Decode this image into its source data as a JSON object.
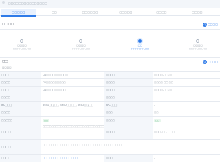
{
  "window": {
    "breadcrumb": "□□□□□□□□□□□□□□□"
  },
  "tabs": [
    {
      "label": "□□□□□",
      "active": true
    },
    {
      "label": "□□",
      "active": false
    },
    {
      "label": "□□□□□□",
      "active": false
    },
    {
      "label": "□□□□□",
      "active": false
    },
    {
      "label": "□□□□",
      "active": false
    },
    {
      "label": "□□□□",
      "active": false
    }
  ],
  "flow": {
    "title": "□□□□",
    "brand": "□□□□",
    "steps": [
      {
        "label": "□□□□",
        "date": "□□□□-□□-□□"
      },
      {
        "label": "□□□□",
        "date": "□□□□-□□-□□"
      },
      {
        "label": "□□",
        "date": "□□□□-□□-□□",
        "current": true
      },
      {
        "label": "□□□□",
        "date": "□□□□-□□-□□"
      }
    ]
  },
  "overview": {
    "title": "□□",
    "brand": "□□□□",
    "subtitle": "□□□□",
    "rows": [
      {
        "l1": "□□□□",
        "v1": "CN□□□□□□□□□□",
        "l2": "□□□□",
        "v2": "□□□□-□□-□□"
      },
      {
        "l1": "□□□□",
        "v1": "CN□□□□□□□□□",
        "l2": "□□□□",
        "v2": "□□□□-□□-□□"
      },
      {
        "l1": "□□□□",
        "v1": "CN□□□□□□□□□",
        "l2": "□□□□",
        "v2": "□□□□-□□-□□"
      },
      {
        "l1": "□□□□",
        "v1": "-",
        "l2": "□□□□",
        "v2": "-"
      },
      {
        "l1": "IPC□□□",
        "v1": "B65G□□/□□, B65D□□/□□, B65D□□/□□",
        "l2": "CPC□□□",
        "v2": "-"
      },
      {
        "l1": "□□□□",
        "v1": "-",
        "l2": "□□□",
        "v2": "□□"
      },
      {
        "l1": "□□□□□",
        "v1": "□□",
        "l2": "□□□□",
        "v2": "□□",
        "badges": true
      },
      {
        "l1": "□□□□□",
        "v1": "□□□□□□□□□□□□□□□□□□□□□□□□□□□□□□□□□□□□□□□□□□□□",
        "l2": "□□□□",
        "v2": "□□□, □□, □□□",
        "tall": true
      },
      {
        "l1": "□□□□□",
        "v1": "□□□□□□□□□□□□□□□□□□□□□□□□□□□□□□□□□□□□□□",
        "wide": true
      },
      {
        "l1": "□□□□",
        "v1": "□□□□□□□□□□□□□□□□",
        "l2": "□□□",
        "v2": "-",
        "link": true
      }
    ]
  }
}
